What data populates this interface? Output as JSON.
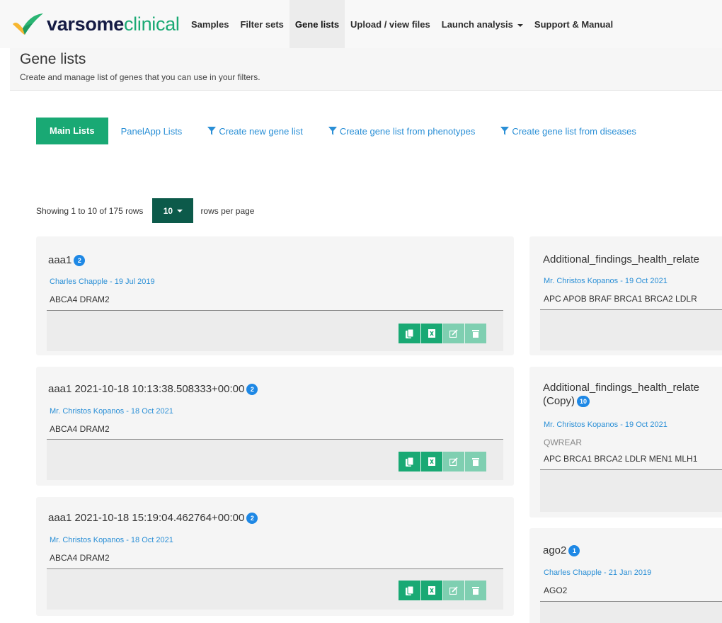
{
  "brand": {
    "part1": "varsome",
    "part2": "clinical"
  },
  "nav": {
    "items": [
      {
        "label": "Samples"
      },
      {
        "label": "Filter sets"
      },
      {
        "label": "Gene lists"
      },
      {
        "label": "Upload / view files"
      },
      {
        "label": "Launch analysis"
      },
      {
        "label": "Support & Manual"
      }
    ],
    "active": "Gene lists"
  },
  "header": {
    "title": "Gene lists",
    "subtitle": "Create and manage list of genes that you can use in your filters."
  },
  "tabs": {
    "main": "Main Lists",
    "panelapp": "PanelApp Lists",
    "create_new": "Create new gene list",
    "from_phenotypes": "Create gene list from phenotypes",
    "from_diseases": "Create gene list from diseases"
  },
  "pagination": {
    "showing": "Showing 1 to 10 of 175 rows",
    "page_size": "10",
    "suffix": "rows per page"
  },
  "cards": [
    {
      "title": "aaa1",
      "count": "2",
      "meta": "Charles Chapple - 19 Jul 2019",
      "description": "",
      "genes": "ABCA4 DRAM2"
    },
    {
      "title": "aaa1 2021-10-18 10:13:38.508333+00:00",
      "count": "2",
      "meta": "Mr. Christos Kopanos - 18 Oct 2021",
      "description": "",
      "genes": "ABCA4 DRAM2"
    },
    {
      "title": "aaa1 2021-10-18 15:19:04.462764+00:00",
      "count": "2",
      "meta": "Mr. Christos Kopanos - 18 Oct 2021",
      "description": "",
      "genes": "ABCA4 DRAM2"
    },
    {
      "title": "Additional_findings_health_relate",
      "count": "",
      "meta": "Mr. Christos Kopanos - 19 Oct 2021",
      "description": "",
      "genes": "APC APOB BRAF BRCA1 BRCA2 LDLR"
    },
    {
      "title": "Additional_findings_health_relate",
      "title_line2": "(Copy)",
      "count": "10",
      "meta": "Mr. Christos Kopanos - 19 Oct 2021",
      "description": "QWREAR",
      "genes": "APC BRCA1 BRCA2 LDLR MEN1 MLH1"
    },
    {
      "title": "ago2",
      "count": "1",
      "meta": "Charles Chapple - 21 Jan 2019",
      "description": "",
      "genes": "AGO2"
    }
  ],
  "icons": {
    "copy": "copy-icon",
    "excel": "excel-icon",
    "edit": "edit-icon",
    "delete": "trash-icon",
    "filter": "filter-icon"
  },
  "colors": {
    "brand_green": "#19a974",
    "brand_navy": "#151b44",
    "link_blue": "#2a8fd6",
    "badge_blue": "#1e88e5",
    "dropdown_dark": "#0c5a4a"
  }
}
